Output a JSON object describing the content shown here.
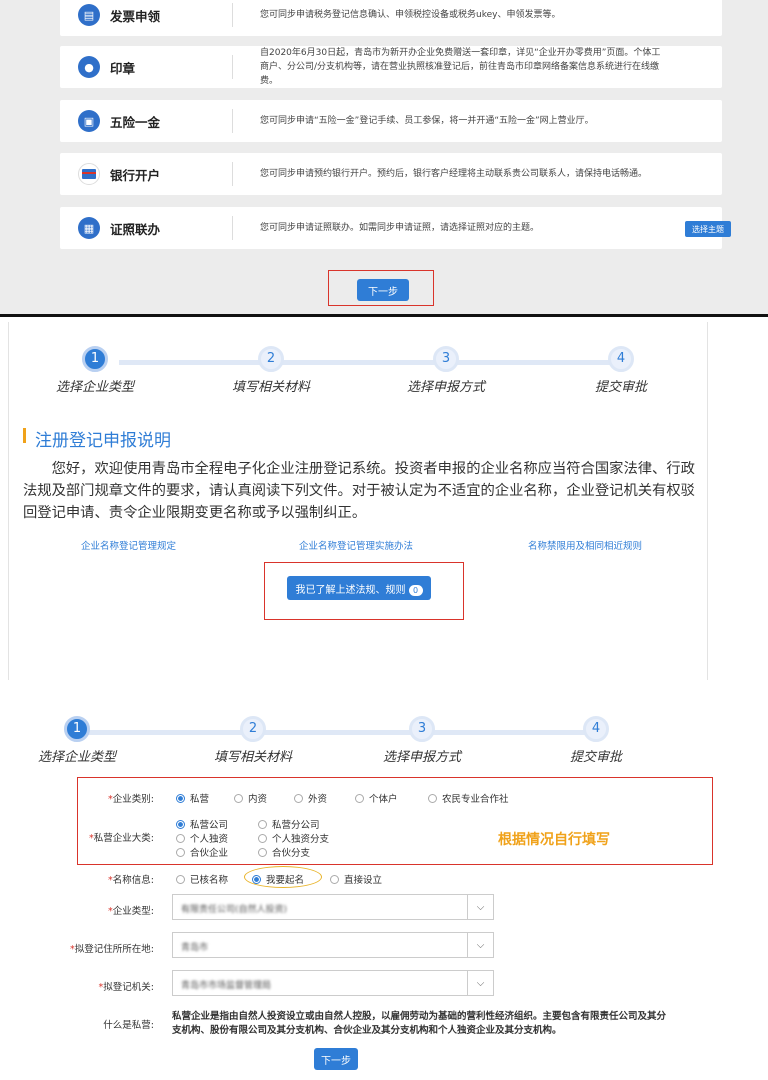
{
  "services": [
    {
      "name": "发票申领",
      "icon": "invoice-icon",
      "desc": "您可同步申请税务登记信息确认、申领税控设备或税务ukey、申领发票等。"
    },
    {
      "name": "印章",
      "icon": "seal-icon",
      "desc": "自2020年6月30日起，青岛市为新开办企业免费赠送一套印章，详见“企业开办零费用”页面。个体工商户、分公司/分支机构等，请在营业执照核准登记后，前往青岛市印章网络备案信息系统进行在线缴费。"
    },
    {
      "name": "五险一金",
      "icon": "insurance-icon",
      "desc": "您可同步申请“五险一金”登记手续、员工参保，将一并开通“五险一金”网上营业厅。"
    },
    {
      "name": "银行开户",
      "icon": "bank-card-icon",
      "desc": "您可同步申请预约银行开户。预约后，银行客户经理将主动联系贵公司联系人，请保持电话畅通。"
    },
    {
      "name": "证照联办",
      "icon": "license-icon",
      "desc": "您可同步申请证照联办。如需同步申请证照，请选择证照对应的主题。"
    }
  ],
  "choose_theme_label": "选择主题",
  "next_label": "下一步",
  "steps": [
    {
      "num": "1",
      "label": "选择企业类型"
    },
    {
      "num": "2",
      "label": "填写相关材料"
    },
    {
      "num": "3",
      "label": "选择申报方式"
    },
    {
      "num": "4",
      "label": "提交审批"
    }
  ],
  "notice": {
    "title": "注册登记申报说明",
    "intro": "您好，欢迎使用青岛市全程电子化企业注册登记系统。投资者申报的企业名称应当符合国家法律、行政法规及部门规章文件的要求，请认真阅读下列文件。对于被认定为不适宜的企业名称，企业登记机关有权驳回登记申请、责令企业限期变更名称或予以强制纠正。",
    "links": [
      "企业名称登记管理规定",
      "企业名称登记管理实施办法",
      "名称禁限用及相同相近规则"
    ],
    "agree_label": "我已了解上述法规、规则",
    "agree_count": "0"
  },
  "form": {
    "company_category_label": "企业类别:",
    "company_category_options": [
      "私营",
      "内资",
      "外资",
      "个体户",
      "农民专业合作社"
    ],
    "private_type_label": "私营企业大类:",
    "private_type_options": [
      "私营公司",
      "私营分公司",
      "个人独资",
      "个人独资分支",
      "合伙企业",
      "合伙分支"
    ],
    "name_info_label": "名称信息:",
    "name_info_options": [
      "已核名称",
      "我要起名",
      "直接设立"
    ],
    "company_type_label": "企业类型:",
    "company_type_value": "有限责任公司(自然人投资)",
    "address_label": "拟登记住所所在地:",
    "address_value": "青岛市",
    "authority_label": "拟登记机关:",
    "authority_value": "青岛市市场监督管理局",
    "what_is_label": "什么是私营:",
    "what_is_desc": "私营企业是指由自然人投资设立或由自然人控股，以雇佣劳动为基础的营利性经济组织。主要包含有限责任公司及其分支机构、股份有限公司及其分支机构、合伙企业及其分支机构和个人独资企业及其分支机构。",
    "annotation": "根据情况自行填写",
    "next_label": "下一步"
  },
  "colors": {
    "accent": "#2f7dd6",
    "highlight": "#d9342b",
    "note": "#f0a21a"
  }
}
